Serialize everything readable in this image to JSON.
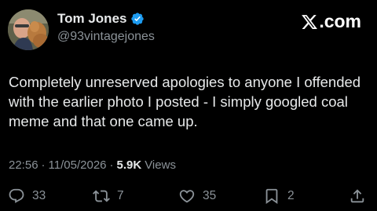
{
  "author": {
    "display_name": "Tom Jones",
    "handle": "@93vintagejones",
    "verified_icon": "verified-badge-icon",
    "avatar_icon": "profile-photo"
  },
  "brand": {
    "label": ".com",
    "logo_icon": "x-logo-icon"
  },
  "tweet": {
    "text": "Completely unreserved apologies to anyone I offended with the earlier photo I posted - I simply googled coal meme and that one came up.",
    "time": "22:56",
    "separator1": "·",
    "date": "11/05/2026",
    "separator2": "·",
    "views_count": "5.9K",
    "views_label": "Views"
  },
  "actions": {
    "replies": "33",
    "reposts": "7",
    "likes": "35",
    "bookmarks": "2"
  },
  "colors": {
    "background": "#000000",
    "text": "#e7e9ea",
    "muted": "#8b9298",
    "verified": "#1d9bf0"
  }
}
